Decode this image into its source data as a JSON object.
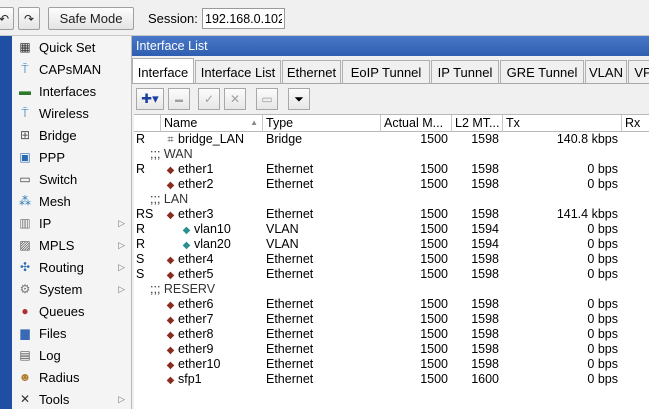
{
  "toolbar": {
    "undo_icon": "↶",
    "redo_icon": "↷",
    "safe_mode_label": "Safe Mode",
    "session_label": "Session:",
    "session_value": "192.168.0.102"
  },
  "sidemenu": {
    "items": [
      {
        "label": "Quick Set",
        "icon": "quickset-icon",
        "glyph": "▦"
      },
      {
        "label": "CAPsMAN",
        "icon": "antenna-icon",
        "glyph": "⍑"
      },
      {
        "label": "Interfaces",
        "icon": "interfaces-icon",
        "glyph": "▬"
      },
      {
        "label": "Wireless",
        "icon": "wireless-icon",
        "glyph": "⍑"
      },
      {
        "label": "Bridge",
        "icon": "bridge-icon",
        "glyph": "⊞"
      },
      {
        "label": "PPP",
        "icon": "ppp-icon",
        "glyph": "▣"
      },
      {
        "label": "Switch",
        "icon": "switch-icon",
        "glyph": "▭"
      },
      {
        "label": "Mesh",
        "icon": "mesh-icon",
        "glyph": "⁂"
      },
      {
        "label": "IP",
        "icon": "ip-icon",
        "glyph": "▥",
        "arrow": "▷"
      },
      {
        "label": "MPLS",
        "icon": "mpls-icon",
        "glyph": "▨",
        "arrow": "▷"
      },
      {
        "label": "Routing",
        "icon": "routing-icon",
        "glyph": "✣",
        "arrow": "▷"
      },
      {
        "label": "System",
        "icon": "gear-icon",
        "glyph": "⚙",
        "arrow": "▷"
      },
      {
        "label": "Queues",
        "icon": "queues-icon",
        "glyph": "●"
      },
      {
        "label": "Files",
        "icon": "folder-icon",
        "glyph": "▆"
      },
      {
        "label": "Log",
        "icon": "log-icon",
        "glyph": "▤"
      },
      {
        "label": "Radius",
        "icon": "radius-icon",
        "glyph": "☻"
      },
      {
        "label": "Tools",
        "icon": "tools-icon",
        "glyph": "✕",
        "arrow": "▷"
      }
    ]
  },
  "window": {
    "title": "Interface List",
    "tabs": [
      "Interface",
      "Interface List",
      "Ethernet",
      "EoIP Tunnel",
      "IP Tunnel",
      "GRE Tunnel",
      "VLAN",
      "VP"
    ],
    "active_tab": "Interface",
    "tools": {
      "add": "✚▾",
      "remove": "▬",
      "enable": "✓",
      "disable": "✕",
      "comment": "▭",
      "filter": "⏷"
    }
  },
  "table": {
    "columns": {
      "flags": "",
      "name": "Name",
      "type": "Type",
      "actual_mtu": "Actual M...",
      "l2_mtu": "L2 MT...",
      "tx": "Tx",
      "rx": "Rx"
    },
    "sort_indicator": "▲",
    "rows": [
      {
        "kind": "iface",
        "flags": "R",
        "icon": "bridge",
        "name": "bridge_LAN",
        "type": "Bridge",
        "mtu": "1500",
        "l2mtu": "1598",
        "tx": "140.8 kbps"
      },
      {
        "kind": "sep",
        "text": ";;; WAN"
      },
      {
        "kind": "iface",
        "flags": "R",
        "icon": "eth",
        "name": "ether1",
        "type": "Ethernet",
        "mtu": "1500",
        "l2mtu": "1598",
        "tx": "0 bps"
      },
      {
        "kind": "iface",
        "flags": "",
        "icon": "eth",
        "name": "ether2",
        "type": "Ethernet",
        "mtu": "1500",
        "l2mtu": "1598",
        "tx": "0 bps"
      },
      {
        "kind": "sep",
        "text": ";;; LAN"
      },
      {
        "kind": "iface",
        "flags": "RS",
        "icon": "eth",
        "name": "ether3",
        "type": "Ethernet",
        "mtu": "1500",
        "l2mtu": "1598",
        "tx": "141.4 kbps"
      },
      {
        "kind": "iface",
        "flags": "R",
        "icon": "vlan",
        "name": "vlan10",
        "type": "VLAN",
        "mtu": "1500",
        "l2mtu": "1594",
        "tx": "0 bps"
      },
      {
        "kind": "iface",
        "flags": "R",
        "icon": "vlan",
        "name": "vlan20",
        "type": "VLAN",
        "mtu": "1500",
        "l2mtu": "1594",
        "tx": "0 bps"
      },
      {
        "kind": "iface",
        "flags": "S",
        "icon": "eth",
        "name": "ether4",
        "type": "Ethernet",
        "mtu": "1500",
        "l2mtu": "1598",
        "tx": "0 bps"
      },
      {
        "kind": "iface",
        "flags": "S",
        "icon": "eth",
        "name": "ether5",
        "type": "Ethernet",
        "mtu": "1500",
        "l2mtu": "1598",
        "tx": "0 bps"
      },
      {
        "kind": "sep",
        "text": ";;; RESERV"
      },
      {
        "kind": "iface",
        "flags": "",
        "icon": "eth",
        "name": "ether6",
        "type": "Ethernet",
        "mtu": "1500",
        "l2mtu": "1598",
        "tx": "0 bps"
      },
      {
        "kind": "iface",
        "flags": "",
        "icon": "eth",
        "name": "ether7",
        "type": "Ethernet",
        "mtu": "1500",
        "l2mtu": "1598",
        "tx": "0 bps"
      },
      {
        "kind": "iface",
        "flags": "",
        "icon": "eth",
        "name": "ether8",
        "type": "Ethernet",
        "mtu": "1500",
        "l2mtu": "1598",
        "tx": "0 bps"
      },
      {
        "kind": "iface",
        "flags": "",
        "icon": "eth",
        "name": "ether9",
        "type": "Ethernet",
        "mtu": "1500",
        "l2mtu": "1598",
        "tx": "0 bps"
      },
      {
        "kind": "iface",
        "flags": "",
        "icon": "eth",
        "name": "ether10",
        "type": "Ethernet",
        "mtu": "1500",
        "l2mtu": "1598",
        "tx": "0 bps"
      },
      {
        "kind": "iface",
        "flags": "",
        "icon": "eth",
        "name": "sfp1",
        "type": "Ethernet",
        "mtu": "1500",
        "l2mtu": "1600",
        "tx": "0 bps"
      }
    ]
  },
  "colors": {
    "title_bar": "#2f5eb0",
    "side_strip": "#1f4fa3",
    "add_icon": "#1a3fa0"
  }
}
